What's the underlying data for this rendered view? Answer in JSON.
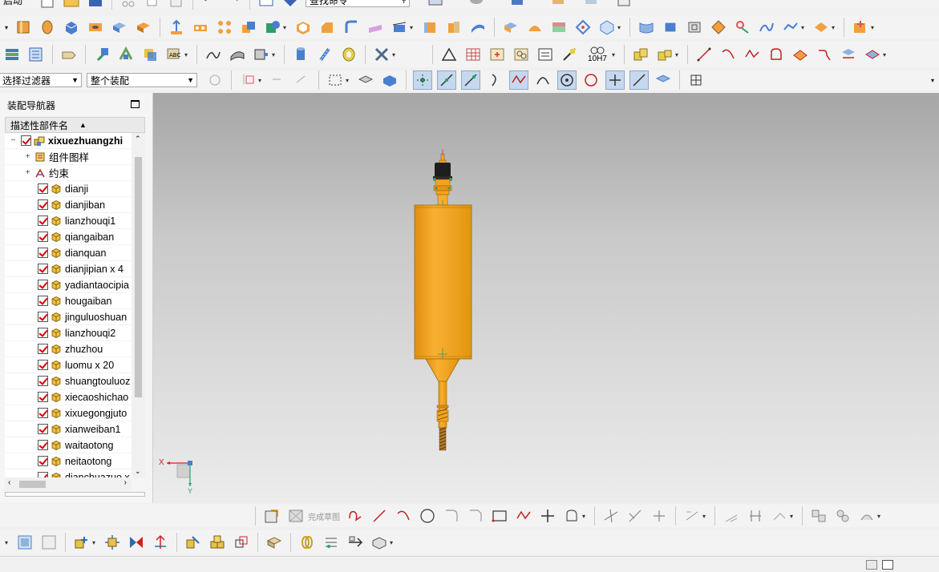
{
  "toolbar": {
    "partial_label_top_left": "启动",
    "command_search_value": "查找命令",
    "selection_filter": "选择过滤器",
    "assembly_scope": "整个装配",
    "tolerance_label": "10H7",
    "finish_sketch_label": "完成草图"
  },
  "navigator": {
    "title": "装配导航器",
    "column_header": "描述性部件名",
    "root": "xixuezhuangzhi",
    "groups": [
      {
        "label": "组件图样"
      },
      {
        "label": "约束"
      }
    ],
    "parts": [
      {
        "label": "dianji"
      },
      {
        "label": "dianjiban"
      },
      {
        "label": "lianzhouqi1"
      },
      {
        "label": "qiangaiban"
      },
      {
        "label": "dianquan"
      },
      {
        "label": "dianjipian x 4"
      },
      {
        "label": "yadiantaocipia"
      },
      {
        "label": "hougaiban"
      },
      {
        "label": "jinguluoshuan"
      },
      {
        "label": "lianzhouqi2"
      },
      {
        "label": "zhuzhou"
      },
      {
        "label": "luomu x 20"
      },
      {
        "label": "shuangtouluoz"
      },
      {
        "label": "xiecaoshichao"
      },
      {
        "label": "xixuegongjuto"
      },
      {
        "label": "xianweiban1"
      },
      {
        "label": "waitaotong"
      },
      {
        "label": "neitaotong"
      },
      {
        "label": "dianchuazuo x"
      }
    ]
  },
  "viewport": {
    "axis_x": "X",
    "axis_y": "Y",
    "model_color": "#f5a31c",
    "motor_color": "#1e1e1e"
  }
}
